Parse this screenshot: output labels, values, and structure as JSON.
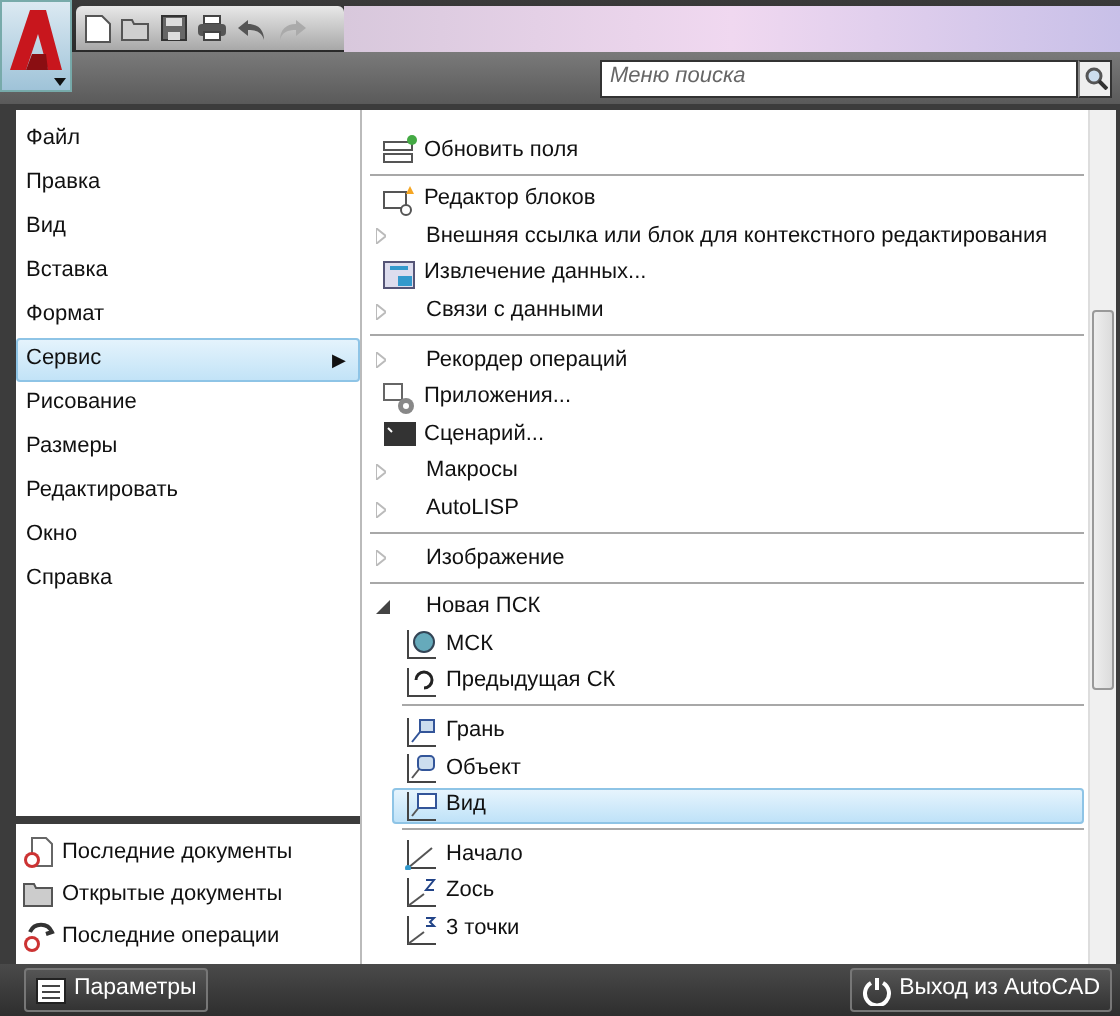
{
  "search": {
    "placeholder": "Меню поиска"
  },
  "menu": [
    {
      "label": "Файл",
      "selected": false
    },
    {
      "label": "Правка",
      "selected": false
    },
    {
      "label": "Вид",
      "selected": false
    },
    {
      "label": "Вставка",
      "selected": false
    },
    {
      "label": "Формат",
      "selected": false
    },
    {
      "label": "Сервис",
      "selected": true,
      "arrow": "▶"
    },
    {
      "label": "Рисование",
      "selected": false
    },
    {
      "label": "Размеры",
      "selected": false
    },
    {
      "label": "Редактировать",
      "selected": false
    },
    {
      "label": "Окно",
      "selected": false
    },
    {
      "label": "Справка",
      "selected": false
    }
  ],
  "recent": [
    {
      "label": "Последние документы"
    },
    {
      "label": "Открытые документы"
    },
    {
      "label": "Последние операции"
    }
  ],
  "submenu": [
    {
      "kind": "command",
      "label": "Обновить поля",
      "selected": false
    },
    {
      "kind": "separator"
    },
    {
      "kind": "command",
      "label": "Редактор блоков",
      "selected": false
    },
    {
      "kind": "submenu",
      "label": "Внешняя ссылка или блок для контекстного редактирования",
      "selected": false,
      "expanded": false
    },
    {
      "kind": "command",
      "label": "Извлечение данных...",
      "selected": false
    },
    {
      "kind": "submenu",
      "label": "Связи с данными",
      "selected": false,
      "expanded": false
    },
    {
      "kind": "separator"
    },
    {
      "kind": "submenu",
      "label": "Рекордер операций",
      "selected": false,
      "expanded": false
    },
    {
      "kind": "command",
      "label": "Приложения...",
      "selected": false
    },
    {
      "kind": "command",
      "label": "Сценарий...",
      "selected": false
    },
    {
      "kind": "submenu",
      "label": "Макросы",
      "selected": false,
      "expanded": false
    },
    {
      "kind": "submenu",
      "label": "AutoLISP",
      "selected": false,
      "expanded": false
    },
    {
      "kind": "separator"
    },
    {
      "kind": "submenu",
      "label": "Изображение",
      "selected": false,
      "expanded": false
    },
    {
      "kind": "separator"
    },
    {
      "kind": "submenu",
      "label": "Новая ПСК",
      "selected": false,
      "expanded": true,
      "children": [
        {
          "kind": "command",
          "label": "МСК",
          "selected": false
        },
        {
          "kind": "command",
          "label": "Предыдущая СК",
          "selected": false
        },
        {
          "kind": "separator"
        },
        {
          "kind": "command",
          "label": "Грань",
          "selected": false
        },
        {
          "kind": "command",
          "label": "Объект",
          "selected": false
        },
        {
          "kind": "command",
          "label": "Вид",
          "selected": true
        },
        {
          "kind": "separator"
        },
        {
          "kind": "command",
          "label": "Начало",
          "selected": false
        },
        {
          "kind": "command",
          "label": "Zось",
          "selected": false
        },
        {
          "kind": "command",
          "label": "3 точки",
          "selected": false
        }
      ]
    }
  ],
  "footer": {
    "options": "Параметры",
    "exit": "Выход из AutoCAD"
  }
}
